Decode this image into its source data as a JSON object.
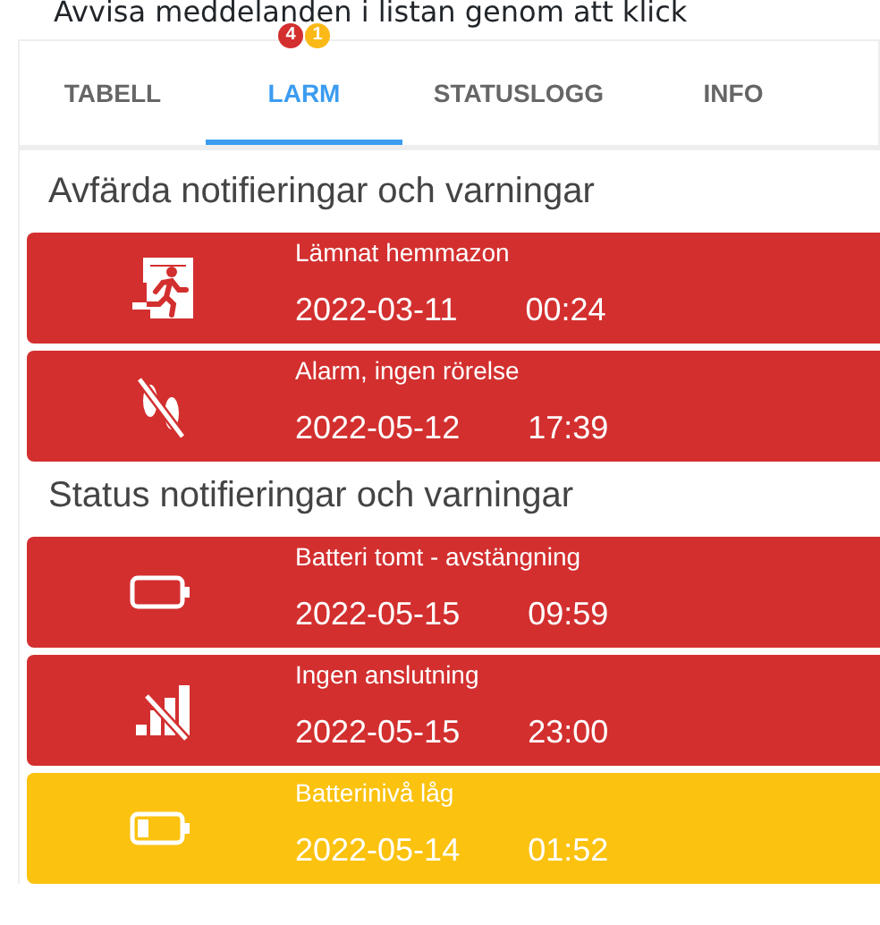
{
  "instruction": "Avvisa meddelanden i listan genom att klick",
  "tabs": [
    {
      "label": "TABELL",
      "selected": false
    },
    {
      "label": "LARM",
      "selected": true,
      "badges": [
        {
          "count": "4",
          "color": "#d32f2f"
        },
        {
          "count": "1",
          "color": "#fbb917"
        }
      ]
    },
    {
      "label": "STATUSLOGG",
      "selected": false
    },
    {
      "label": "INFO",
      "selected": false
    }
  ],
  "sections": [
    {
      "title": "Avfärda notifieringar och varningar",
      "items": [
        {
          "kind": "exit",
          "title": "Lämnat hemmazon",
          "date": "2022-03-11",
          "time": "00:24",
          "color": "#d32f2f"
        },
        {
          "kind": "no-motion",
          "title": "Alarm, ingen rörelse",
          "date": "2022-05-12",
          "time": "17:39",
          "color": "#d32f2f"
        }
      ]
    },
    {
      "title": "Status notifieringar och varningar",
      "items": [
        {
          "kind": "battery-empty",
          "title": "Batteri tomt - avstängning",
          "date": "2022-05-15",
          "time": "09:59",
          "color": "#d32f2f"
        },
        {
          "kind": "no-signal",
          "title": "Ingen anslutning",
          "date": "2022-05-15",
          "time": "23:00",
          "color": "#d32f2f"
        },
        {
          "kind": "battery-low",
          "title": "Batterinivå låg",
          "date": "2022-05-14",
          "time": "01:52",
          "color": "#fbc20f"
        }
      ]
    }
  ]
}
